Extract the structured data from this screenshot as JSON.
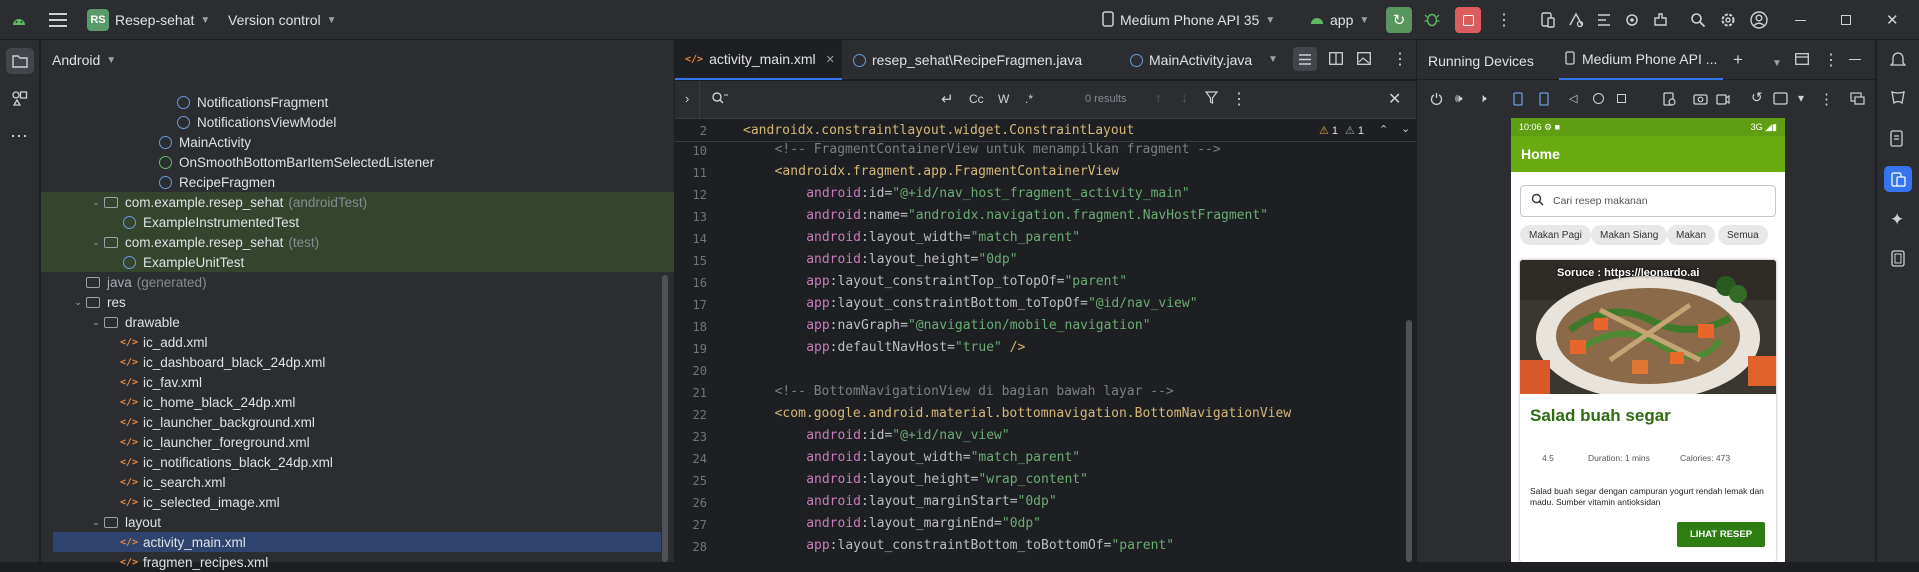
{
  "titlebar": {
    "project_badge": "RS",
    "project_name": "Resep-sehat",
    "vcs": "Version control",
    "device": "Medium Phone API 35",
    "run_config": "app"
  },
  "project": {
    "view": "Android",
    "tree": [
      {
        "label": "NotificationsFragment",
        "type": "class",
        "depth": 6
      },
      {
        "label": "NotificationsViewModel",
        "type": "class",
        "depth": 6
      },
      {
        "label": "MainActivity",
        "type": "class",
        "depth": 5
      },
      {
        "label": "OnSmoothBottomBarItemSelectedListener",
        "type": "iface",
        "depth": 5
      },
      {
        "label": "RecipeFragmen",
        "type": "class",
        "depth": 5
      },
      {
        "label": "com.example.resep_sehat",
        "suffix": "(androidTest)",
        "type": "pkg",
        "depth": 2,
        "expanded": true,
        "hl": true
      },
      {
        "label": "ExampleInstrumentedTest",
        "type": "class",
        "depth": 3,
        "hl": true
      },
      {
        "label": "com.example.resep_sehat",
        "suffix": "(test)",
        "type": "pkg",
        "depth": 2,
        "expanded": true,
        "hl": true
      },
      {
        "label": "ExampleUnitTest",
        "type": "class",
        "depth": 3,
        "hl": true
      },
      {
        "label": "java",
        "suffix": "(generated)",
        "type": "folder",
        "depth": 1
      },
      {
        "label": "res",
        "type": "folder",
        "depth": 1,
        "expanded": true
      },
      {
        "label": "drawable",
        "type": "folder",
        "depth": 2,
        "expanded": true
      },
      {
        "label": "ic_add.xml",
        "type": "xml",
        "depth": 3
      },
      {
        "label": "ic_dashboard_black_24dp.xml",
        "type": "xml",
        "depth": 3
      },
      {
        "label": "ic_fav.xml",
        "type": "xml",
        "depth": 3
      },
      {
        "label": "ic_home_black_24dp.xml",
        "type": "xml",
        "depth": 3
      },
      {
        "label": "ic_launcher_background.xml",
        "type": "xml",
        "depth": 3
      },
      {
        "label": "ic_launcher_foreground.xml",
        "type": "xml",
        "depth": 3
      },
      {
        "label": "ic_notifications_black_24dp.xml",
        "type": "xml",
        "depth": 3
      },
      {
        "label": "ic_search.xml",
        "type": "xml",
        "depth": 3
      },
      {
        "label": "ic_selected_image.xml",
        "type": "xml",
        "depth": 3
      },
      {
        "label": "layout",
        "type": "folder",
        "depth": 2,
        "expanded": true
      },
      {
        "label": "activity_main.xml",
        "type": "xml",
        "depth": 3,
        "selected": true
      },
      {
        "label": "fragmen_recipes.xml",
        "type": "xml",
        "depth": 3
      }
    ]
  },
  "editor": {
    "tabs": [
      {
        "label": "activity_main.xml",
        "icon": "xml-icon",
        "active": true
      },
      {
        "label": "resep_sehat\\RecipeFragmen.java",
        "icon": "class-icon"
      },
      {
        "label": "MainActivity.java",
        "icon": "class-icon"
      }
    ],
    "find": {
      "results": "0 results",
      "case": "Cc",
      "word": "W",
      "regex": ".*"
    },
    "sticky": {
      "num": "2",
      "text": "<androidx.constraintlayout.widget.ConstraintLayout"
    },
    "warnings": {
      "a": "1",
      "b": "1"
    },
    "lines": [
      {
        "n": "10",
        "indent": 4,
        "parts": [
          [
            "com",
            "<!-- FragmentContainerView untuk menampilkan fragment -->"
          ]
        ]
      },
      {
        "n": "11",
        "indent": 4,
        "parts": [
          [
            "tag",
            "<androidx.fragment.app.FragmentContainerView"
          ]
        ]
      },
      {
        "n": "12",
        "indent": 8,
        "parts": [
          [
            "attr",
            "android"
          ],
          [
            "ns",
            ":id="
          ],
          [
            "val",
            "\"@+id/nav_host_fragment_activity_main\""
          ]
        ]
      },
      {
        "n": "13",
        "indent": 8,
        "parts": [
          [
            "attr",
            "android"
          ],
          [
            "ns",
            ":name="
          ],
          [
            "val",
            "\"androidx.navigation.fragment.NavHostFragment\""
          ]
        ]
      },
      {
        "n": "14",
        "indent": 8,
        "parts": [
          [
            "attr",
            "android"
          ],
          [
            "ns",
            ":layout_width="
          ],
          [
            "val",
            "\"match_parent\""
          ]
        ]
      },
      {
        "n": "15",
        "indent": 8,
        "parts": [
          [
            "attr",
            "android"
          ],
          [
            "ns",
            ":layout_height="
          ],
          [
            "val",
            "\"0dp\""
          ]
        ]
      },
      {
        "n": "16",
        "indent": 8,
        "parts": [
          [
            "attr",
            "app"
          ],
          [
            "ns",
            ":layout_constraintTop_toTopOf="
          ],
          [
            "val",
            "\"parent\""
          ]
        ]
      },
      {
        "n": "17",
        "indent": 8,
        "parts": [
          [
            "attr",
            "app"
          ],
          [
            "ns",
            ":layout_constraintBottom_toTopOf="
          ],
          [
            "val",
            "\"@id/nav_view\""
          ]
        ]
      },
      {
        "n": "18",
        "indent": 8,
        "parts": [
          [
            "attr",
            "app"
          ],
          [
            "ns",
            ":navGraph="
          ],
          [
            "val",
            "\"@navigation/mobile_navigation\""
          ]
        ]
      },
      {
        "n": "19",
        "indent": 8,
        "parts": [
          [
            "attr",
            "app"
          ],
          [
            "ns",
            ":defaultNavHost="
          ],
          [
            "val",
            "\"true\""
          ],
          [
            "tag",
            " />"
          ]
        ]
      },
      {
        "n": "20",
        "indent": 0,
        "parts": []
      },
      {
        "n": "21",
        "indent": 4,
        "parts": [
          [
            "com",
            "<!-- BottomNavigationView di bagian bawah layar -->"
          ]
        ]
      },
      {
        "n": "22",
        "indent": 4,
        "parts": [
          [
            "tag",
            "<com.google.android.material.bottomnavigation.BottomNavigationView"
          ]
        ]
      },
      {
        "n": "23",
        "indent": 8,
        "parts": [
          [
            "attr",
            "android"
          ],
          [
            "ns",
            ":id="
          ],
          [
            "val",
            "\"@+id/nav_view\""
          ]
        ]
      },
      {
        "n": "24",
        "indent": 8,
        "parts": [
          [
            "attr",
            "android"
          ],
          [
            "ns",
            ":layout_width="
          ],
          [
            "val",
            "\"match_parent\""
          ]
        ]
      },
      {
        "n": "25",
        "indent": 8,
        "parts": [
          [
            "attr",
            "android"
          ],
          [
            "ns",
            ":layout_height="
          ],
          [
            "val",
            "\"wrap_content\""
          ]
        ]
      },
      {
        "n": "26",
        "indent": 8,
        "parts": [
          [
            "attr",
            "android"
          ],
          [
            "ns",
            ":layout_marginStart="
          ],
          [
            "val",
            "\"0dp\""
          ]
        ]
      },
      {
        "n": "27",
        "indent": 8,
        "parts": [
          [
            "attr",
            "android"
          ],
          [
            "ns",
            ":layout_marginEnd="
          ],
          [
            "val",
            "\"0dp\""
          ]
        ]
      },
      {
        "n": "28",
        "indent": 8,
        "parts": [
          [
            "attr",
            "app"
          ],
          [
            "ns",
            ":layout_constraintBottom_toBottomOf="
          ],
          [
            "val",
            "\"parent\""
          ]
        ]
      }
    ]
  },
  "running": {
    "title": "Running Devices",
    "device_tab": "Medium Phone API ..."
  },
  "phone": {
    "time": "10:06",
    "network": "3G",
    "app_title": "Home",
    "search_placeholder": "Cari resep makanan",
    "chips": [
      "Makan Pagi",
      "Makan Siang",
      "Makan",
      "Semua"
    ],
    "image_caption": "Soruce : https://leonardo.ai",
    "recipe_title": "Salad buah segar",
    "rating": "4.5",
    "duration": "Duration: 1 mins",
    "calories": "Calories: 473",
    "description": "Salad buah segar dengan campuran yogurt rendah lemak dan madu. Sumber vitamin antioksidan",
    "button": "LIHAT RESEP"
  },
  "colors": {
    "accent": "#3574f0",
    "run": "#5fb865",
    "stop": "#db5c5c",
    "app_bar": "#6aab12",
    "recipe_title": "#2e6b12"
  }
}
